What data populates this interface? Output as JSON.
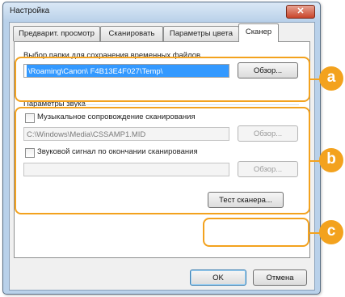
{
  "window": {
    "title": "Настройка",
    "close_symbol": "✕"
  },
  "tabs": [
    {
      "label": "Предварит. просмотр"
    },
    {
      "label": "Сканировать"
    },
    {
      "label": "Параметры цвета"
    },
    {
      "label": "Сканер"
    }
  ],
  "folder": {
    "label": "Выбор папки для сохранения временных файлов",
    "path": "\\Roaming\\Canon\\          F4B13E4F027\\Temp\\",
    "browse_label": "Обзор..."
  },
  "sound": {
    "group_label": "Параметры звука",
    "music_checkbox_label": "Музыкальное сопровождение сканирования",
    "music_path": "C:\\Windows\\Media\\CSSAMP1.MID",
    "music_browse_label": "Обзор...",
    "beep_checkbox_label": "Звуковой сигнал по окончании сканирования",
    "beep_path": "",
    "beep_browse_label": "Обзор..."
  },
  "test_button_label": "Тест сканера...",
  "footer": {
    "ok_label": "OK",
    "cancel_label": "Отмена"
  },
  "callouts": [
    "a",
    "b",
    "c"
  ],
  "colors": {
    "callout": "#f3a21e",
    "selection": "#3399ff"
  }
}
